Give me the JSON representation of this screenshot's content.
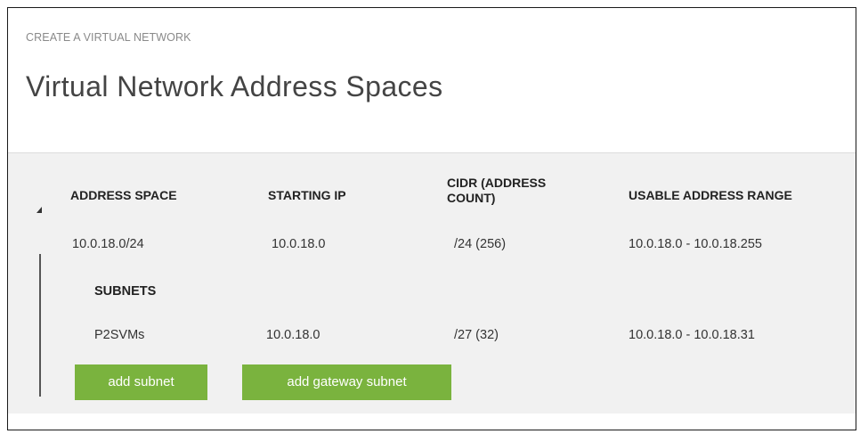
{
  "breadcrumb": "CREATE A VIRTUAL NETWORK",
  "title": "Virtual Network Address Spaces",
  "table": {
    "headers": {
      "address_space": "ADDRESS SPACE",
      "starting_ip": "STARTING IP",
      "cidr_line1": "CIDR (ADDRESS",
      "cidr_line2": "COUNT)",
      "usable_range": "USABLE ADDRESS RANGE"
    },
    "address_space_row": {
      "address_space": "10.0.18.0/24",
      "starting_ip": "10.0.18.0",
      "cidr": "/24 (256)",
      "usable_range": "10.0.18.0 - 10.0.18.255"
    },
    "subnets": {
      "heading": "SUBNETS",
      "rows": [
        {
          "name": "P2SVMs",
          "starting_ip": "10.0.18.0",
          "cidr": "/27 (32)",
          "usable_range": "10.0.18.0 - 10.0.18.31"
        }
      ]
    },
    "buttons": {
      "add_subnet": "add subnet",
      "add_gateway_subnet": "add gateway subnet"
    }
  },
  "colors": {
    "accent_green": "#7ab33e",
    "panel_bg": "#f1f1f1"
  },
  "icons": {
    "collapse": "collapse-triangle-icon"
  }
}
